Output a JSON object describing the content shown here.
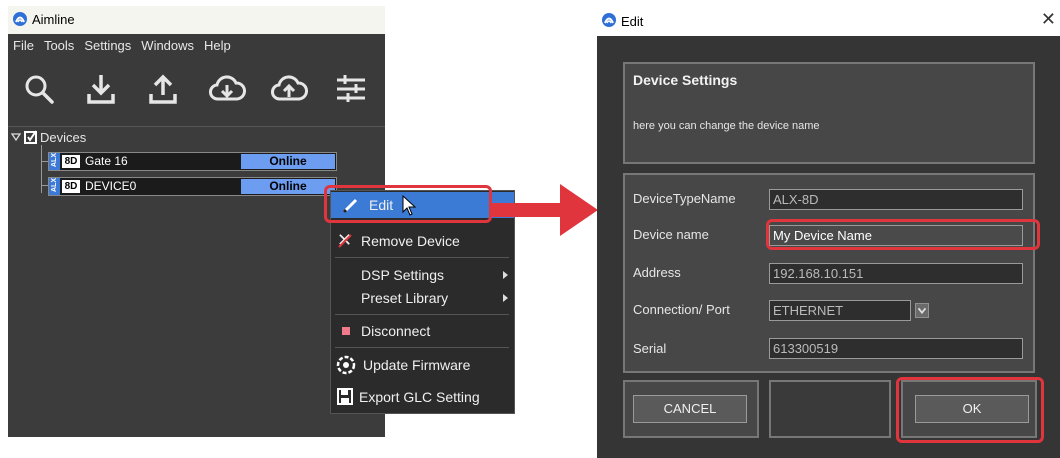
{
  "left_window": {
    "title": "Aimline",
    "menu": [
      "File",
      "Tools",
      "Settings",
      "Windows",
      "Help"
    ],
    "toolbar_icons": [
      "search-icon",
      "download-icon",
      "upload-icon",
      "cloud-download-icon",
      "cloud-upload-icon",
      "sliders-icon"
    ],
    "tree": {
      "root_label": "Devices",
      "devices": [
        {
          "badge": "ALX",
          "model": "8D",
          "name": "Gate 16",
          "status": "Online"
        },
        {
          "badge": "ALX",
          "model": "8D",
          "name": "DEVICE0",
          "status": "Online"
        }
      ]
    }
  },
  "context_menu": {
    "items": {
      "edit": "Edit",
      "remove": "Remove Device",
      "dsp": "DSP Settings",
      "preset": "Preset Library",
      "disconnect": "Disconnect",
      "firmware": "Update Firmware",
      "export": "Export GLC Setting"
    }
  },
  "edit_dialog": {
    "title": "Edit",
    "close_glyph": "✕",
    "header": {
      "title": "Device Settings",
      "description": "here you can change the device name"
    },
    "fields": {
      "type": {
        "label": "DeviceTypeName",
        "value": "ALX-8D"
      },
      "name": {
        "label": "Device name",
        "value": "My Device Name"
      },
      "address": {
        "label": "Address",
        "value": "192.168.10.151"
      },
      "port": {
        "label": "Connection/ Port",
        "value": "ETHERNET"
      },
      "serial": {
        "label": "Serial",
        "value": "613300519"
      }
    },
    "buttons": {
      "cancel": "CANCEL",
      "ok": "OK"
    }
  },
  "colors": {
    "accent_blue": "#3b7bd6",
    "status_online": "#6d9df0",
    "highlight_red": "#e0353d"
  }
}
